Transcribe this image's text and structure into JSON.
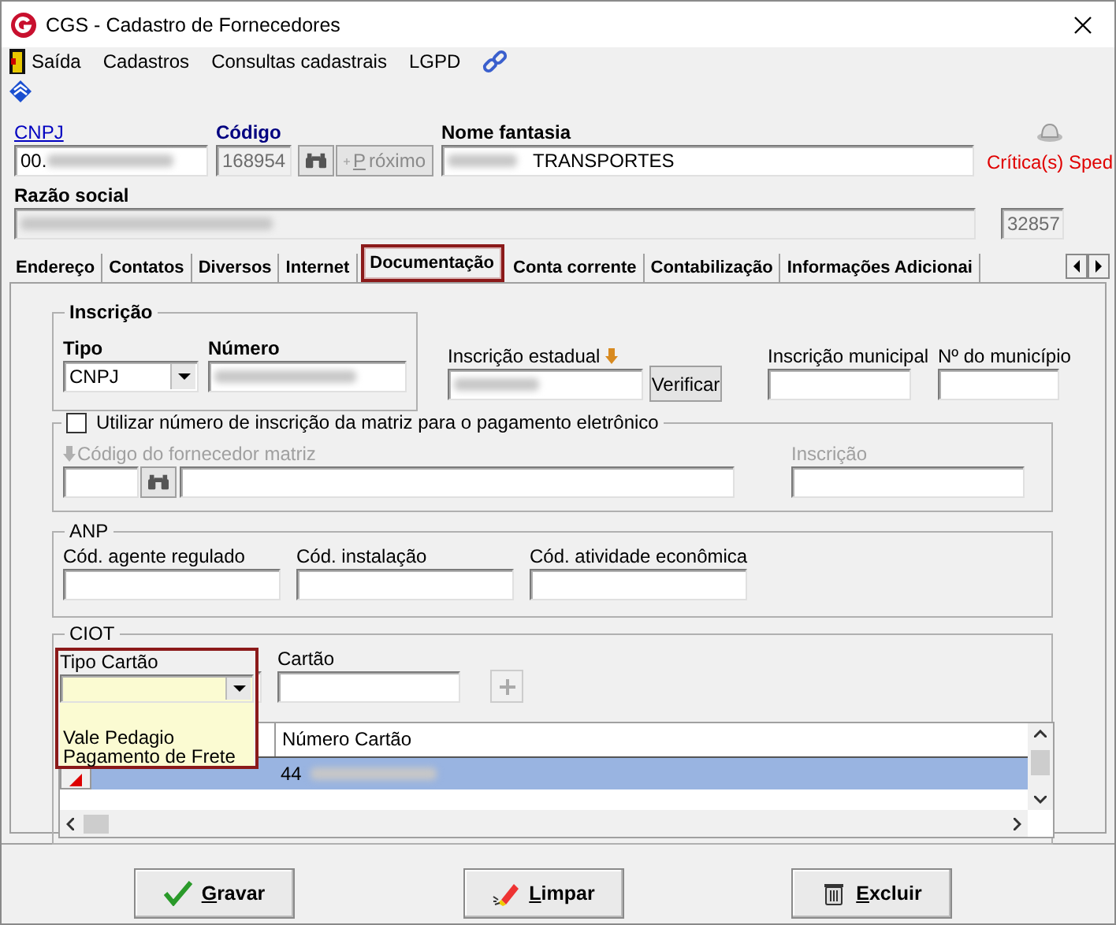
{
  "window": {
    "title": "CGS - Cadastro de Fornecedores"
  },
  "menu": [
    {
      "label": "Saída",
      "kind": "exit"
    },
    {
      "label": "Cadastros",
      "kind": "plain"
    },
    {
      "label": "Consultas cadastrais",
      "kind": "plain"
    },
    {
      "label": "LGPD",
      "kind": "plain"
    }
  ],
  "header": {
    "cnpj_label": "CNPJ",
    "cnpj_value": "00.",
    "codigo_label": "Código",
    "codigo_value": "168954",
    "proximo_button": "Próximo",
    "nome_fantasia_label": "Nome fantasia",
    "nome_fantasia_value": "TRANSPORTES",
    "critica": "Crítica(s) Sped",
    "razao_social_label": "Razão social",
    "razao_social_number": "32857"
  },
  "tabs": [
    {
      "label": "Endereço",
      "selected": false
    },
    {
      "label": "Contatos",
      "selected": false
    },
    {
      "label": "Diversos",
      "selected": false
    },
    {
      "label": "Internet",
      "selected": false
    },
    {
      "label": "Documentação",
      "selected": true
    },
    {
      "label": "Conta corrente",
      "selected": false
    },
    {
      "label": "Contabilização",
      "selected": false
    },
    {
      "label": "Informações Adicionai",
      "selected": false
    }
  ],
  "inscricao": {
    "title": "Inscrição",
    "tipo_label": "Tipo",
    "tipo_value": "CNPJ",
    "numero_label": "Número",
    "estadual_label": "Inscrição estadual",
    "verificar_button": "Verificar",
    "municipal_label": "Inscrição municipal",
    "municipio_label": "Nº do município"
  },
  "matriz": {
    "checkbox_label": "Utilizar número de inscrição da matriz para o pagamento eletrônico",
    "checked": false,
    "codigo_label": "Código do fornecedor matriz",
    "inscricao_label": "Inscrição"
  },
  "anp": {
    "title": "ANP",
    "fields": [
      "Cód. agente regulado",
      "Cód. instalação",
      "Cód. atividade econômica"
    ]
  },
  "ciot": {
    "title": "CIOT",
    "tipo_cartao_label": "Tipo Cartão",
    "cartao_label": "Cartão",
    "options": [
      "Vale Pedagio",
      "Pagamento de Frete"
    ],
    "grid": {
      "column": "Número Cartão",
      "rows": [
        {
          "value": "44",
          "selected": true
        }
      ]
    }
  },
  "buttons": [
    {
      "label": "Gravar",
      "kind": "save"
    },
    {
      "label": "Limpar",
      "kind": "clear"
    },
    {
      "label": "Excluir",
      "kind": "delete"
    }
  ]
}
